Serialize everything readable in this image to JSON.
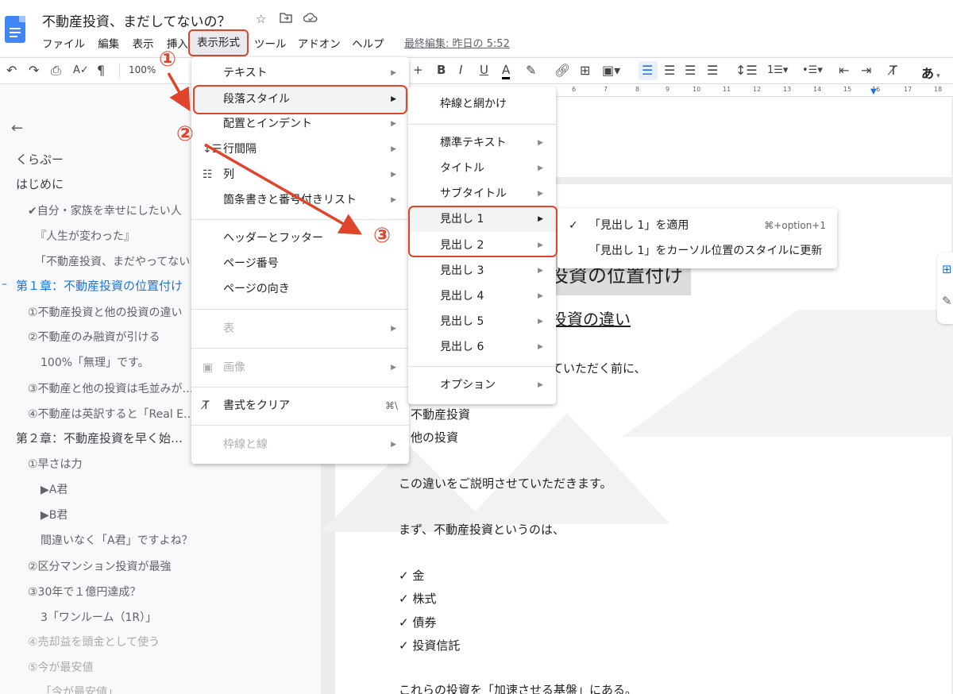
{
  "header": {
    "title": "不動産投資、まだしてないの？",
    "icons": [
      "star-icon",
      "move-to-folder-icon",
      "cloud-saved-icon"
    ],
    "menus": [
      "ファイル",
      "編集",
      "表示",
      "挿入"
    ],
    "menu_format": "表示形式",
    "menus_after": [
      "ツール",
      "アドオン",
      "ヘルプ"
    ],
    "last_edit": "最終編集: 昨日の 5:52"
  },
  "toolbar": {
    "zoom": "100%",
    "ime": "あ",
    "ruler_ticks": [
      "6",
      "7",
      "8",
      "9",
      "10",
      "11",
      "12",
      "13",
      "14",
      "15",
      "16",
      "17",
      "18"
    ]
  },
  "outline": {
    "items": [
      {
        "text": "くらぷー",
        "level": 2
      },
      {
        "text": "はじめに",
        "level": 2
      },
      {
        "text": "✔自分・家族を幸せにしたい人",
        "level": 3
      },
      {
        "text": "『人生が変わった』",
        "level": 3
      },
      {
        "text": "「不動産投資、まだやってない…",
        "level": 3
      },
      {
        "text": "第１章：不動産投資の位置付け",
        "level": 2,
        "active": true
      },
      {
        "text": "①不動産投資と他の投資の違い",
        "level": 3
      },
      {
        "text": "②不動産のみ融資が引ける",
        "level": 3
      },
      {
        "text": "100%「無理」です。",
        "level": 4
      },
      {
        "text": "③不動産と他の投資は毛並みが…",
        "level": 3
      },
      {
        "text": "④不動産は英訳すると「Real E…",
        "level": 3
      },
      {
        "text": "第２章：不動産投資を早く始…",
        "level": 2
      },
      {
        "text": "①早さは力",
        "level": 3
      },
      {
        "text": "▶A君",
        "level": 4
      },
      {
        "text": "▶B君",
        "level": 4
      },
      {
        "text": "間違いなく「A君」ですよね？",
        "level": 4
      },
      {
        "text": "②区分マンション投資が最強",
        "level": 3
      },
      {
        "text": "③30年で１億円達成？",
        "level": 3
      },
      {
        "text": "3「ワンルーム（1R）」",
        "level": 4
      },
      {
        "text": "④売却益を頭金として使う",
        "level": 3
      },
      {
        "text": "⑤今が最安値",
        "level": 3
      },
      {
        "text": "「今が最安値」",
        "level": 4
      }
    ]
  },
  "format_menu": {
    "items": [
      {
        "label": "テキスト",
        "arrow": true
      },
      {
        "label": "段落スタイル",
        "arrow": true,
        "highlighted": true
      },
      {
        "label": "配置とインデント",
        "arrow": true
      },
      {
        "label": "行間隔",
        "arrow": true,
        "icon": "line-spacing-icon"
      },
      {
        "label": "列",
        "arrow": true,
        "icon": "columns-icon"
      },
      {
        "label": "箇条書きと番号付きリスト",
        "arrow": true
      },
      {
        "label": "ヘッダーとフッター"
      },
      {
        "label": "ページ番号"
      },
      {
        "label": "ページの向き"
      },
      {
        "label": "表",
        "arrow": true,
        "disabled": true
      },
      {
        "label": "画像",
        "arrow": true,
        "disabled": true,
        "icon": "image-icon"
      },
      {
        "label": "書式をクリア",
        "shortcut": "⌘\\",
        "icon": "clear-formatting-icon"
      },
      {
        "label": "枠線と線",
        "arrow": true,
        "disabled": true
      }
    ]
  },
  "paragraph_menu": {
    "items": [
      {
        "label": "枠線と網かけ"
      },
      {
        "label": "標準テキスト",
        "arrow": true
      },
      {
        "label": "タイトル",
        "arrow": true
      },
      {
        "label": "サブタイトル",
        "arrow": true
      },
      {
        "label": "見出し 1",
        "arrow": true,
        "highlighted": true
      },
      {
        "label": "見出し 2",
        "arrow": true
      },
      {
        "label": "見出し 3",
        "arrow": true
      },
      {
        "label": "見出し 4",
        "arrow": true
      },
      {
        "label": "見出し 5",
        "arrow": true
      },
      {
        "label": "見出し 6",
        "arrow": true
      },
      {
        "label": "オプション",
        "arrow": true
      }
    ]
  },
  "heading_submenu": {
    "items": [
      {
        "label": "「見出し 1」を適用",
        "shortcut": "⌘+option+1",
        "checked": true
      },
      {
        "label": "「見出し 1」をカーソル位置のスタイルに更新"
      }
    ]
  },
  "annotations": {
    "step1": "①",
    "step2": "②",
    "step3": "③",
    "color": "#e0452c"
  },
  "document": {
    "heading1_partial": "投資の位置付け",
    "heading2_partial": "投資の違い",
    "line_partial": "ていただく前に、",
    "body": [
      "不動産投資",
      "他の投資",
      "この違いをご説明させていただきます。",
      "まず、不動産投資というのは、",
      "✓ 金",
      "✓ 株式",
      "✓ 債券",
      "✓ 投資信託",
      "これらの投資を「加速させる基盤」にある。"
    ]
  }
}
